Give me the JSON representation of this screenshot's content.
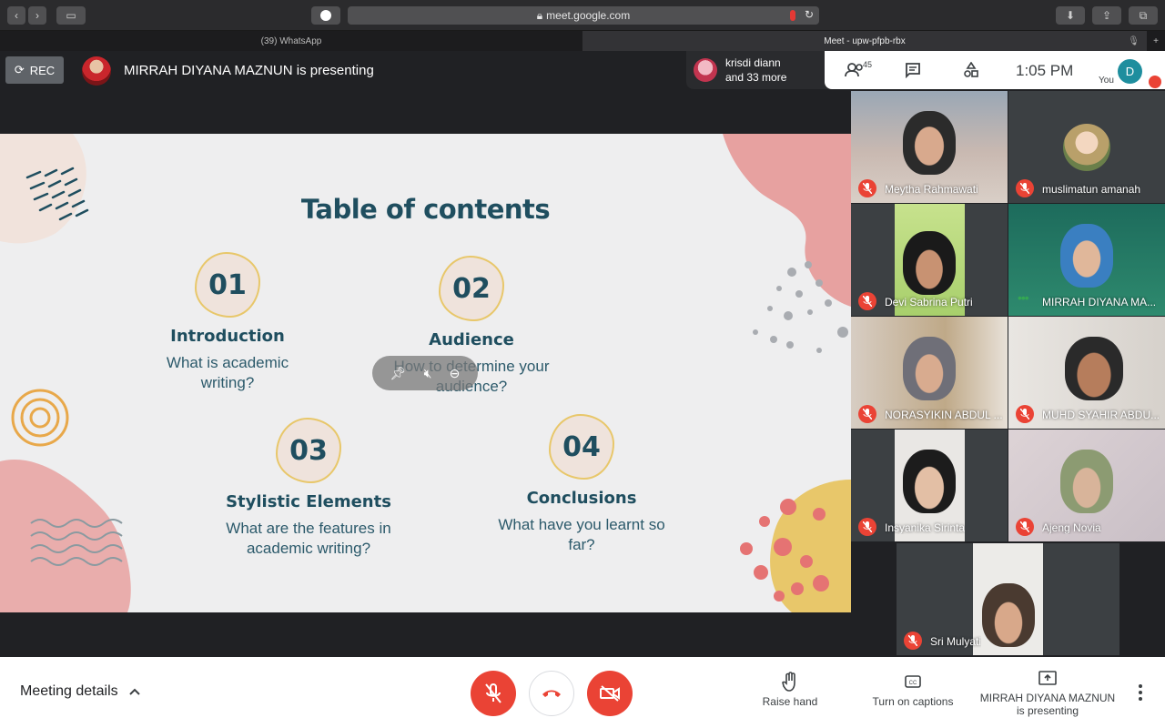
{
  "browser": {
    "url": "meet.google.com",
    "tabs": [
      {
        "label": "(39) WhatsApp",
        "active": false
      },
      {
        "label": "Meet - upw-pfpb-rbx",
        "active": true
      }
    ]
  },
  "topbar": {
    "rec_label": "REC",
    "presenting_text": "MIRRAH DIYANA MAZNUN is presenting",
    "pill_line1": "krisdi diann",
    "pill_line2": "and 33 more",
    "participant_count": "45",
    "time": "1:05 PM",
    "you_initial": "D",
    "you_label": "You"
  },
  "slide": {
    "title": "Table of contents",
    "items": [
      {
        "number": "01",
        "heading": "Introduction",
        "description": "What is academic writing?"
      },
      {
        "number": "02",
        "heading": "Audience",
        "description": "How to determine your audience?"
      },
      {
        "number": "03",
        "heading": "Stylistic Elements",
        "description": "What are the features in academic writing?"
      },
      {
        "number": "04",
        "heading": "Conclusions",
        "description": "What have you learnt so far?"
      }
    ],
    "colors": {
      "text": "#1f4e5f",
      "blob_border": "#e8c76a",
      "pink": "#e7a1a0",
      "yellow": "#e8c76a"
    }
  },
  "participants": [
    {
      "name": "Meytha Rahmawati",
      "muted": true
    },
    {
      "name": "muslimatun amanah",
      "muted": true
    },
    {
      "name": "Devi Sabrina Putri",
      "muted": true
    },
    {
      "name": "MIRRAH DIYANA MA...",
      "muted": false
    },
    {
      "name": "NORASYIKIN ABDUL ...",
      "muted": true
    },
    {
      "name": "MUHD SYAHIR ABDU...",
      "muted": true
    },
    {
      "name": "Insyanika Sirinta",
      "muted": true
    },
    {
      "name": "Ajeng Novia",
      "muted": true
    },
    {
      "name": "Sri Mulyati",
      "muted": true
    }
  ],
  "bottombar": {
    "meeting_details": "Meeting details",
    "raise_hand": "Raise hand",
    "captions": "Turn on captions",
    "presenting_line1": "MIRRAH DIYANA MAZNUN",
    "presenting_line2": "is presenting"
  }
}
